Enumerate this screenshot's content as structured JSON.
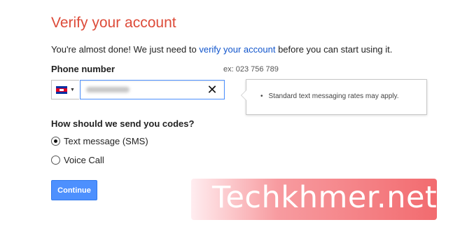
{
  "page": {
    "title": "Verify your account"
  },
  "intro": {
    "before": "You're almost done! We just need to ",
    "link": "verify your account",
    "after": " before you can start using it."
  },
  "phone": {
    "label": "Phone number",
    "example": "ex: 023 756 789",
    "country_icon": "cambodia-flag-icon",
    "value": "",
    "clear_icon": "close-icon",
    "clear_glyph": "✕"
  },
  "tooltip": {
    "bullet": "•",
    "text": "Standard text messaging rates may apply."
  },
  "delivery": {
    "question": "How should we send you codes?",
    "options": [
      {
        "label": "Text message (SMS)",
        "selected": true
      },
      {
        "label": "Voice Call",
        "selected": false
      }
    ]
  },
  "actions": {
    "continue_label": "Continue"
  },
  "watermark": {
    "text": "Techkhmer.net"
  },
  "colors": {
    "title": "#dd4b39",
    "link": "#1155cc",
    "primary_button": "#4d90fe",
    "input_focus_border": "#4d90fe"
  }
}
